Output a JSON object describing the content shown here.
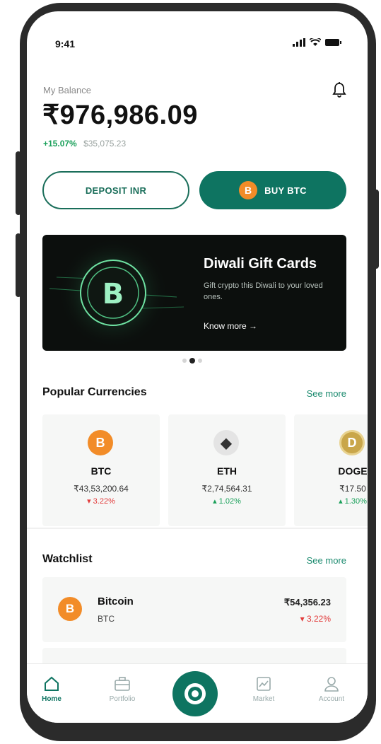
{
  "status": {
    "time": "9:41"
  },
  "balance": {
    "label": "My Balance",
    "value": "₹976,986.09",
    "change_pct": "+15.07%",
    "change_amt": "$35,075.23"
  },
  "actions": {
    "deposit_label": "DEPOSIT INR",
    "buy_label": "BUY BTC",
    "buy_coin_symbol": "B"
  },
  "banner": {
    "title": "Diwali Gift Cards",
    "subtitle": "Gift crypto this Diwali to your loved ones.",
    "link": "Know more →",
    "page_count": 3,
    "active_page": 2
  },
  "popular": {
    "title": "Popular Currencies",
    "see_more": "See more",
    "items": [
      {
        "symbol": "BTC",
        "price": "₹43,53,200.64",
        "change": "▾ 3.22%",
        "direction": "down",
        "icon": "bitcoin-icon",
        "glyph": "B"
      },
      {
        "symbol": "ETH",
        "price": "₹2,74,564.31",
        "change": "▴ 1.02%",
        "direction": "up",
        "icon": "ethereum-icon",
        "glyph": "◆"
      },
      {
        "symbol": "DOGE",
        "price": "₹17.50",
        "change": "▴ 1.30%",
        "direction": "up",
        "icon": "dogecoin-icon",
        "glyph": "D"
      }
    ]
  },
  "watchlist": {
    "title": "Watchlist",
    "see_more": "See more",
    "items": [
      {
        "name": "Bitcoin",
        "code": "BTC",
        "price": "₹54,356.23",
        "change": "▾ 3.22%",
        "direction": "down",
        "icon": "bitcoin-icon",
        "glyph": "B"
      }
    ]
  },
  "tabbar": {
    "items": [
      {
        "label": "Home",
        "icon": "home-icon",
        "active": true
      },
      {
        "label": "Portfolio",
        "icon": "portfolio-icon",
        "active": false
      },
      {
        "label": "",
        "icon": "scan-coin-icon",
        "active": false
      },
      {
        "label": "Market",
        "icon": "market-chart-icon",
        "active": false
      },
      {
        "label": "Account",
        "icon": "account-icon",
        "active": false
      }
    ]
  },
  "colors": {
    "brand": "#0e7461",
    "up": "#1aa05a",
    "down": "#e23b3b",
    "bitcoin": "#f28c28"
  }
}
